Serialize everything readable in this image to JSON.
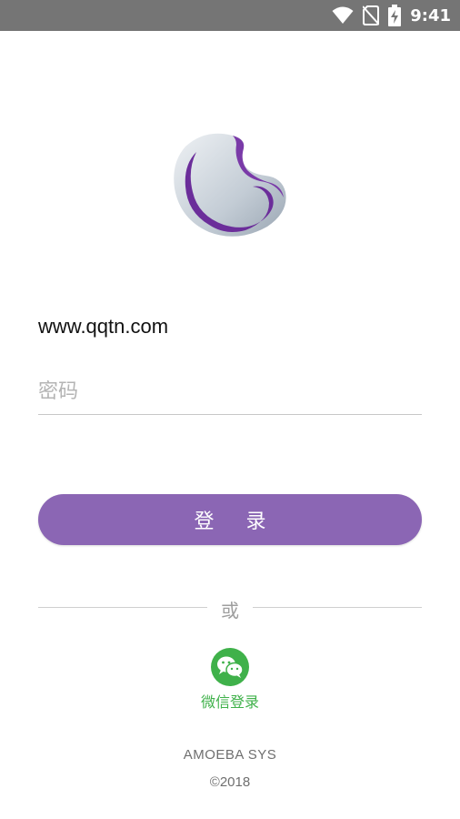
{
  "status_bar": {
    "time": "9:41",
    "icons": [
      "wifi-icon",
      "no-sim-icon",
      "battery-charging-icon"
    ]
  },
  "login": {
    "username_value": "www.qqtn.com",
    "password_placeholder": "密码",
    "login_button": "登 录",
    "divider_text": "或",
    "wechat_label": "微信登录"
  },
  "footer": {
    "brand": "AMOEBA SYS",
    "copyright": "©2018"
  },
  "colors": {
    "accent": "#8b66b4",
    "wechat": "#3fb14a",
    "status_bar": "#757575"
  }
}
